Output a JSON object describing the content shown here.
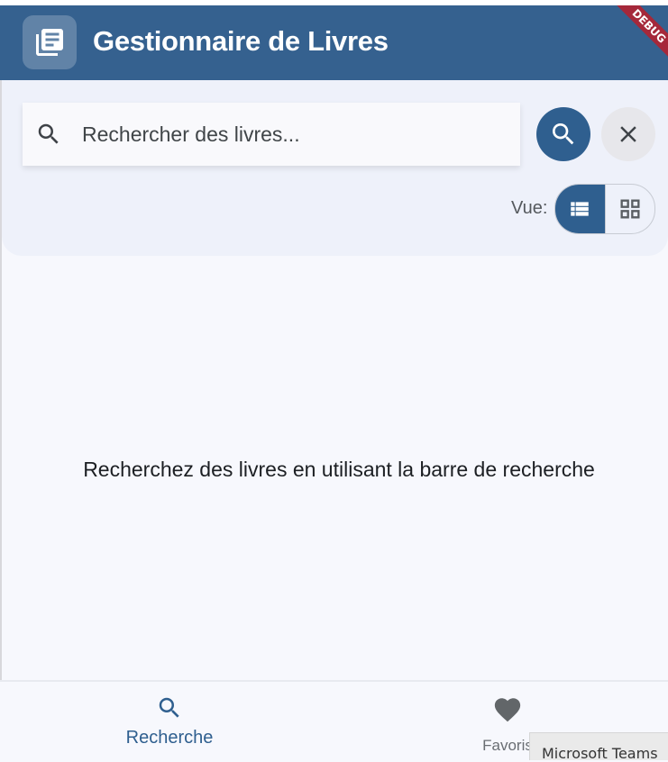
{
  "header": {
    "title": "Gestionnaire de Livres",
    "app_icon": "library-books-icon",
    "debug_banner": "DEBUG"
  },
  "search": {
    "placeholder": "Rechercher des livres...",
    "value": "",
    "input_icon": "search-icon",
    "submit_icon": "search-icon",
    "clear_icon": "close-icon"
  },
  "view": {
    "label": "Vue:",
    "options": [
      {
        "name": "list",
        "icon": "view-list-icon",
        "selected": true
      },
      {
        "name": "grid",
        "icon": "grid-view-icon",
        "selected": false
      }
    ]
  },
  "main": {
    "empty_message": "Recherchez des livres en utilisant la barre de recherche"
  },
  "bottom_nav": {
    "items": [
      {
        "label": "Recherche",
        "icon": "search-icon",
        "active": true
      },
      {
        "label": "Favoris",
        "icon": "heart-icon",
        "active": false
      }
    ]
  },
  "taskbar_toast": {
    "label": "Microsoft Teams"
  },
  "colors": {
    "primary": "#35618f",
    "background": "#f7f8fd",
    "debug_ribbon": "#a5283a"
  }
}
